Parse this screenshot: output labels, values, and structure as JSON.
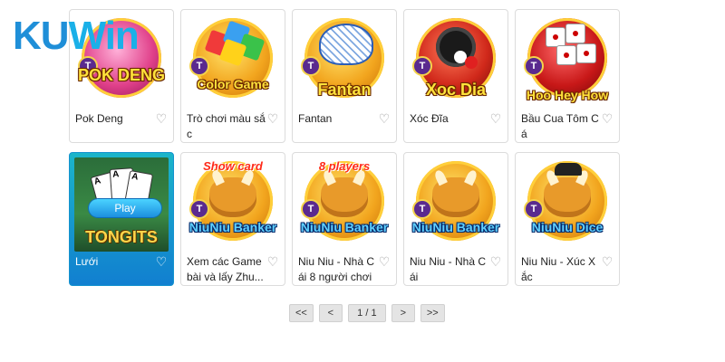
{
  "brand": {
    "logo_ku": "KU",
    "logo_win": "Win"
  },
  "games": [
    {
      "label": "Pok Deng",
      "art_text": "POK DENG"
    },
    {
      "label": "Trò chơi màu sắc",
      "art_text": "Color Game"
    },
    {
      "label": "Fantan",
      "art_text": "Fantan"
    },
    {
      "label": "Xóc Đĩa",
      "art_text": "Xoc Dia"
    },
    {
      "label": "Bầu Cua Tôm Cá",
      "art_text": "Hoo Hey How"
    },
    {
      "label": "Lưới",
      "art_text": "TONGITS",
      "play_label": "Play"
    },
    {
      "label": "Xem các Game bài và lấy Zhu...",
      "art_text": "NiuNiu Banker",
      "ribbon": "Show card"
    },
    {
      "label": "Niu Niu - Nhà Cái 8 người chơi",
      "art_text": "NiuNiu Banker",
      "ribbon": "8 players"
    },
    {
      "label": "Niu Niu - Nhà Cái",
      "art_text": "NiuNiu Banker"
    },
    {
      "label": "Niu Niu - Xúc Xắc",
      "art_text": "NiuNiu Dice"
    }
  ],
  "badge_letter": "T",
  "heart_icon": "♡",
  "pagination": {
    "first": "<<",
    "prev": "<",
    "current": "1 / 1",
    "next": ">",
    "last": ">>"
  }
}
